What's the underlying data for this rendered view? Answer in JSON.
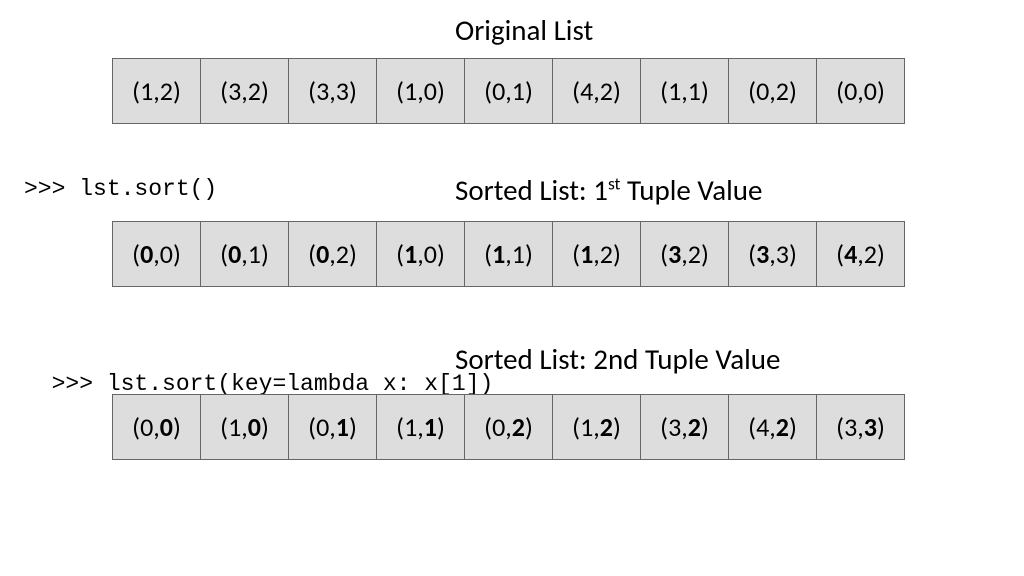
{
  "titles": {
    "original": "Original List",
    "sorted1_prefix": "Sorted List: 1",
    "sorted1_sup": "st",
    "sorted1_suffix": " Tuple Value",
    "sorted2": "Sorted List: 2nd Tuple Value"
  },
  "code": {
    "line1": ">>> lst.sort()",
    "line2_a": ">>> lst.sort(key=lambda x: ",
    "line2_b": "x[1]",
    "line2_c": ")"
  },
  "rows": {
    "original": [
      {
        "a": "1",
        "b": "2"
      },
      {
        "a": "3",
        "b": "2"
      },
      {
        "a": "3",
        "b": "3"
      },
      {
        "a": "1",
        "b": "0"
      },
      {
        "a": "0",
        "b": "1"
      },
      {
        "a": "4",
        "b": "2"
      },
      {
        "a": "1",
        "b": "1"
      },
      {
        "a": "0",
        "b": "2"
      },
      {
        "a": "0",
        "b": "0"
      }
    ],
    "sorted1": [
      {
        "a": "0",
        "b": "0"
      },
      {
        "a": "0",
        "b": "1"
      },
      {
        "a": "0",
        "b": "2"
      },
      {
        "a": "1",
        "b": "0"
      },
      {
        "a": "1",
        "b": "1"
      },
      {
        "a": "1",
        "b": "2"
      },
      {
        "a": "3",
        "b": "2"
      },
      {
        "a": "3",
        "b": "3"
      },
      {
        "a": "4",
        "b": "2"
      }
    ],
    "sorted2": [
      {
        "a": "0",
        "b": "0"
      },
      {
        "a": "1",
        "b": "0"
      },
      {
        "a": "0",
        "b": "1"
      },
      {
        "a": "1",
        "b": "1"
      },
      {
        "a": "0",
        "b": "2"
      },
      {
        "a": "1",
        "b": "2"
      },
      {
        "a": "3",
        "b": "2"
      },
      {
        "a": "4",
        "b": "2"
      },
      {
        "a": "3",
        "b": "3"
      }
    ]
  },
  "chart_data": {
    "type": "table",
    "title": "Python list sort by tuple element",
    "original": [
      [
        1,
        2
      ],
      [
        3,
        2
      ],
      [
        3,
        3
      ],
      [
        1,
        0
      ],
      [
        0,
        1
      ],
      [
        4,
        2
      ],
      [
        1,
        1
      ],
      [
        0,
        2
      ],
      [
        0,
        0
      ]
    ],
    "sorted_by_first": [
      [
        0,
        0
      ],
      [
        0,
        1
      ],
      [
        0,
        2
      ],
      [
        1,
        0
      ],
      [
        1,
        1
      ],
      [
        1,
        2
      ],
      [
        3,
        2
      ],
      [
        3,
        3
      ],
      [
        4,
        2
      ]
    ],
    "sorted_by_second": [
      [
        0,
        0
      ],
      [
        1,
        0
      ],
      [
        0,
        1
      ],
      [
        1,
        1
      ],
      [
        0,
        2
      ],
      [
        1,
        2
      ],
      [
        3,
        2
      ],
      [
        4,
        2
      ],
      [
        3,
        3
      ]
    ]
  }
}
